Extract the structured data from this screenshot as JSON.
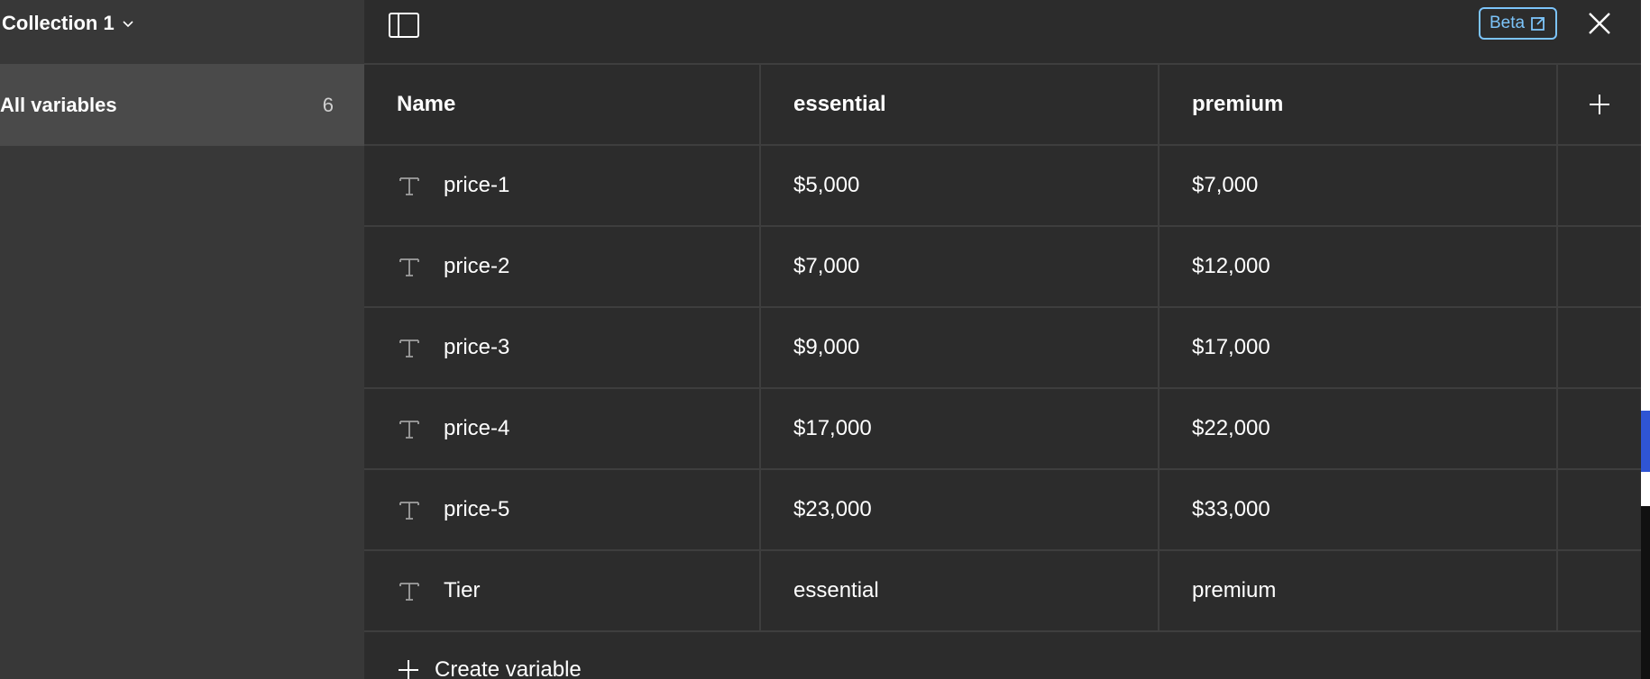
{
  "sidebar": {
    "collection_title": "Collection 1",
    "items": [
      {
        "label": "All variables",
        "count": "6"
      }
    ]
  },
  "topbar": {
    "beta_label": "Beta"
  },
  "table": {
    "columns": [
      "Name",
      "essential",
      "premium"
    ],
    "rows": [
      {
        "name": "price-1",
        "essential": "$5,000",
        "premium": "$7,000"
      },
      {
        "name": "price-2",
        "essential": "$7,000",
        "premium": "$12,000"
      },
      {
        "name": "price-3",
        "essential": "$9,000",
        "premium": "$17,000"
      },
      {
        "name": "price-4",
        "essential": "$17,000",
        "premium": "$22,000"
      },
      {
        "name": "price-5",
        "essential": "$23,000",
        "premium": "$33,000"
      },
      {
        "name": "Tier",
        "essential": "essential",
        "premium": "premium"
      }
    ],
    "create_label": "Create variable"
  },
  "colors": {
    "panel_bg": "#2c2c2c",
    "sidebar_bg": "#383838",
    "selected_bg": "#4a4a4a",
    "accent": "#7cc4fa"
  }
}
